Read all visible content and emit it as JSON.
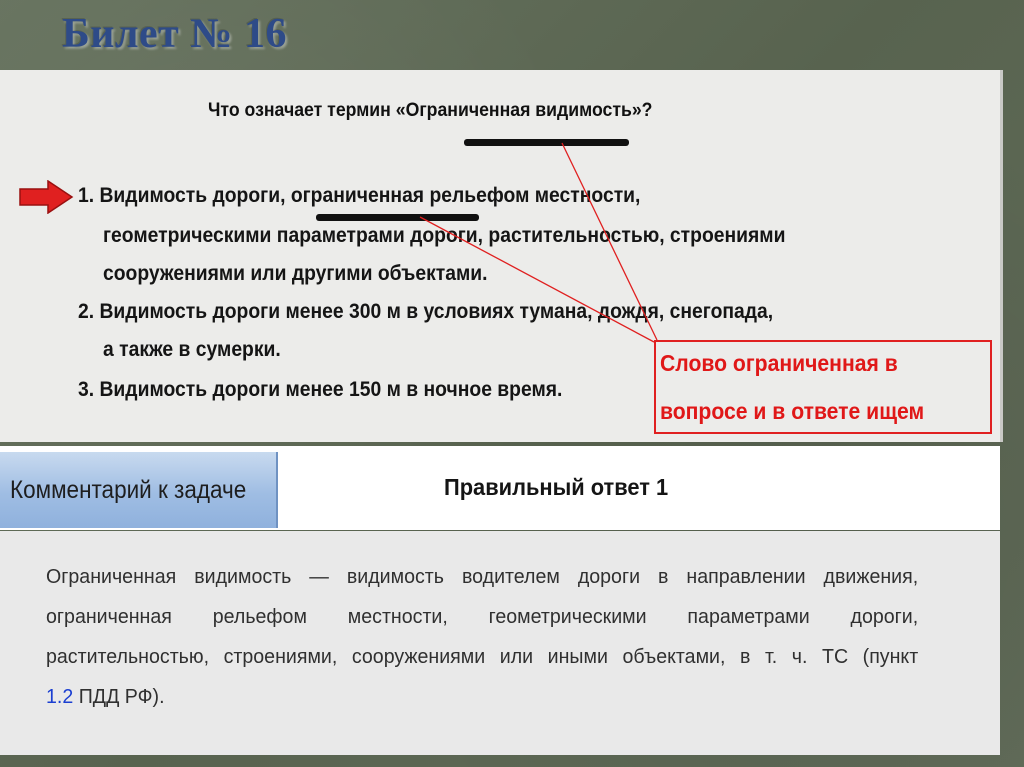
{
  "slide": {
    "title": "Билет № 16"
  },
  "question": "Что означает термин «Ограниченная видимость»?",
  "answers": {
    "a1_l1_pre": "1. Видимость дороги, ",
    "a1_l1_word": "ограниченная",
    "a1_l1_post": " рельефом местности,",
    "a1_l2": "геометрическими параметрами дороги, растительностью, строениями",
    "a1_l3": "сооружениями или другими объектами.",
    "a2_l1": "2. Видимость дороги менее 300 м в условиях тумана, дождя, снегопада,",
    "a2_l2": "а также в сумерки.",
    "a3_l1": "3. Видимость дороги менее 150 м в ночное время."
  },
  "annotation": {
    "line1": "Слово ограниченная в",
    "line2": "вопросе и в ответе ищем",
    "color": "#e01818"
  },
  "comment": {
    "tab_label": "Комментарий к задаче",
    "correct_answer": "Правильный ответ  1",
    "line1": "Ограниченная видимость — видимость водителем дороги в направлении движения,",
    "line2": "ограниченная рельефом местности, геометрическими параметрами дороги,",
    "line3": "растительностью, строениями, сооружениями или иными объектами, в т. ч. ТС (пункт",
    "link": "1.2",
    "line4_post": " ПДД РФ)."
  },
  "colors": {
    "title": "#2e4b88",
    "arrow": "#e02020",
    "link": "#1b3fd1",
    "tab_gradient_top": "#c8daef",
    "tab_gradient_bottom": "#8fb1dd"
  }
}
